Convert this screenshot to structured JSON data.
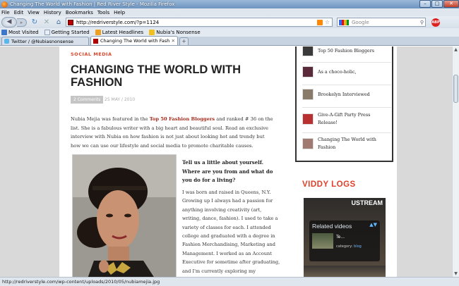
{
  "window": {
    "title": "Changing The World with Fashion | Red River Style - Mozilla Firefox",
    "minimize": "–",
    "maximize": "□",
    "close": "✕"
  },
  "menu": [
    "File",
    "Edit",
    "View",
    "History",
    "Bookmarks",
    "Tools",
    "Help"
  ],
  "nav": {
    "back_icon": "◀",
    "forward_icon": "▸",
    "reload_icon": "↻",
    "stop_icon": "✕",
    "home_icon": "⌂",
    "url": "http://redriverstyle.com/?p=1124",
    "star_icon": "☆",
    "search_placeholder": "Google",
    "search_icon": "⚲",
    "abp_label": "ABP"
  },
  "bookmarks": [
    {
      "label": "Most Visited",
      "color": "#3f77c8"
    },
    {
      "label": "Getting Started",
      "color": "#e8eef5"
    },
    {
      "label": "Latest Headlines",
      "color": "#f0a020"
    },
    {
      "label": "Nubia's Nonsense",
      "color": "#f0c020"
    }
  ],
  "tabs": [
    {
      "label": "Twitter / @Nubiasnonsense",
      "color": "#5ab6e8",
      "active": false
    },
    {
      "label": "Changing The World with Fashion ...",
      "color": "#b00000",
      "active": true
    }
  ],
  "new_tab_label": "+",
  "article": {
    "category": "SOCIAL MEDIA",
    "title": "CHANGING THE WORLD WITH FASHION",
    "comments": "2 Comments",
    "date": "25 MAY / 2010",
    "intro_before": "Nubia Mejia was featured in the ",
    "intro_link": "Top 50 Fashion Bloggers",
    "intro_after": " and ranked # 36 on the list. She is a fabulous writer with a big heart and beautiful soul. Read an exclusive interview with Nubia on how fashion is not just about looking hot and trendy but how we can use our lifestyle and social media to promote charitable causes.",
    "question": "Tell us a little about yourself. Where are you from and what do you do for a living?",
    "answer": "I was born and raised in Queens, N.Y. Growing up I always had a passion for anything involving creativity (art, writing, dance, fashion). I used to take a variety of classes for each.  I attended college and graduated with a degree in Fashion Merchandising, Marketing and Management.  I worked as an Account Executive for sometime after graduating, and I'm currently exploring my"
  },
  "sidebar": {
    "posts": [
      {
        "title": "Top 50 Fashion Bloggers",
        "thumb": "#3a3a3a"
      },
      {
        "title": "As a choco-holic,",
        "thumb": "#5a2a3a"
      },
      {
        "title": "Brookelyn Interviewed",
        "thumb": "#8a7a6a"
      },
      {
        "title": "Give-A-Gift Party Press Release!",
        "thumb": "#b83030"
      },
      {
        "title": "Changing The World with Fashion",
        "thumb": "#a07a70"
      }
    ],
    "viddy_heading": "VIDDY LOGS",
    "video": {
      "brand": "USTREAM",
      "related": "Related videos",
      "arrows": "▲▼",
      "item_text": "Te...",
      "category_label": "category: ",
      "category_value": "blog"
    }
  },
  "status": "http://redriverstyle.com/wp-content/uploads/2010/05/nubiamejia.jpg"
}
